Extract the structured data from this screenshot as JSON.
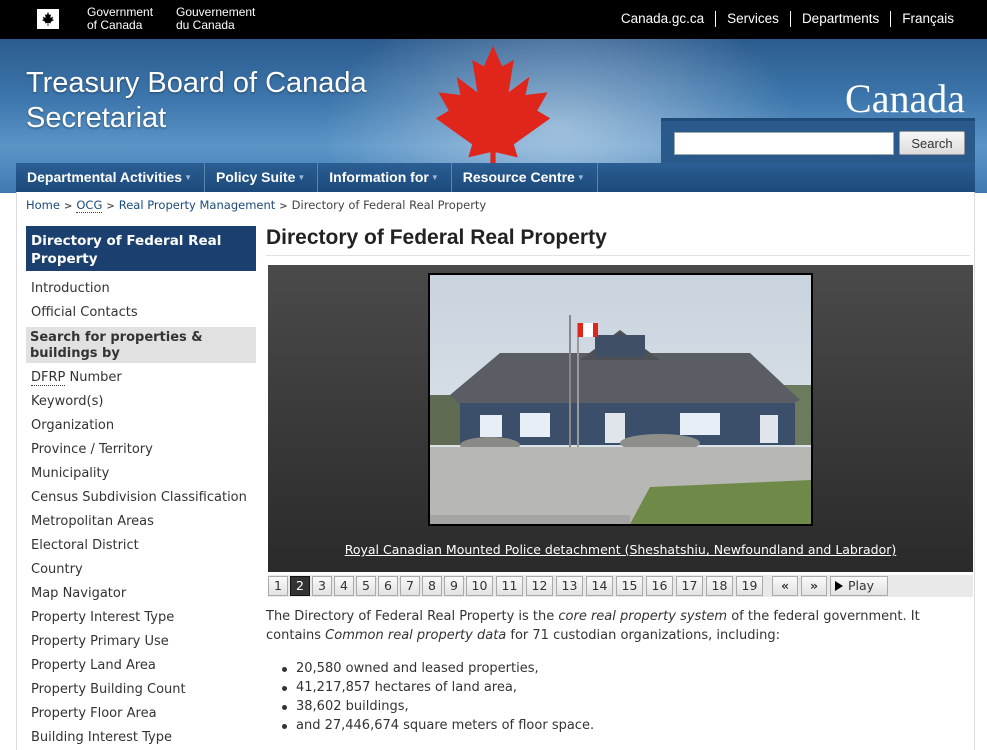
{
  "fip": {
    "gov_en_line1": "Government",
    "gov_en_line2": "of Canada",
    "gov_fr_line1": "Gouvernement",
    "gov_fr_line2": "du Canada",
    "links": [
      "Canada.gc.ca",
      "Services",
      "Departments",
      "Français"
    ]
  },
  "banner": {
    "title_line1": "Treasury Board of Canada",
    "title_line2": "Secretariat",
    "wordmark": "Canada",
    "search_button": "Search",
    "search_value": ""
  },
  "menu": [
    "Departmental Activities",
    "Policy Suite",
    "Information for",
    "Resource Centre"
  ],
  "breadcrumb": {
    "home": "Home",
    "ocg": "OCG",
    "rpm": "Real Property Management",
    "current": "Directory of Federal Real Property"
  },
  "leftnav": {
    "heading": "Directory of Federal Real Property",
    "items_top": [
      "Introduction",
      "Official Contacts"
    ],
    "subheading": "Search for properties & buildings by",
    "dfrp_abbr": "DFRP",
    "dfrp_rest": " Number",
    "items": [
      "Keyword(s)",
      "Organization",
      "Province / Territory",
      "Municipality",
      "Census Subdivision Classification",
      "Metropolitan Areas",
      "Electoral District",
      "Country",
      "Map Navigator",
      "Property Interest Type",
      "Property Primary Use",
      "Property Land Area",
      "Property Building Count",
      "Property Floor Area",
      "Building Interest Type"
    ]
  },
  "main": {
    "title": "Directory of Federal Real Property",
    "caption": "Royal Canadian Mounted Police detachment (Sheshatshiu, Newfoundland and Labrador)",
    "pager": [
      "1",
      "2",
      "3",
      "4",
      "5",
      "6",
      "7",
      "8",
      "9",
      "10",
      "11",
      "12",
      "13",
      "14",
      "15",
      "16",
      "17",
      "18",
      "19"
    ],
    "pager_active": "2",
    "prev_label": "«",
    "next_label": "»",
    "play_label": "Play",
    "intro_a": "The Directory of Federal Real Property is the ",
    "intro_em1": "core real property system",
    "intro_b": " of the federal government. It contains ",
    "intro_em2": "Common real property data",
    "intro_c": " for 71 custodian organizations, including:",
    "stats": [
      "20,580 owned and leased properties,",
      "41,217,857 hectares of land area,",
      "38,602 buildings,",
      "and 27,446,674 square meters of floor space."
    ]
  }
}
